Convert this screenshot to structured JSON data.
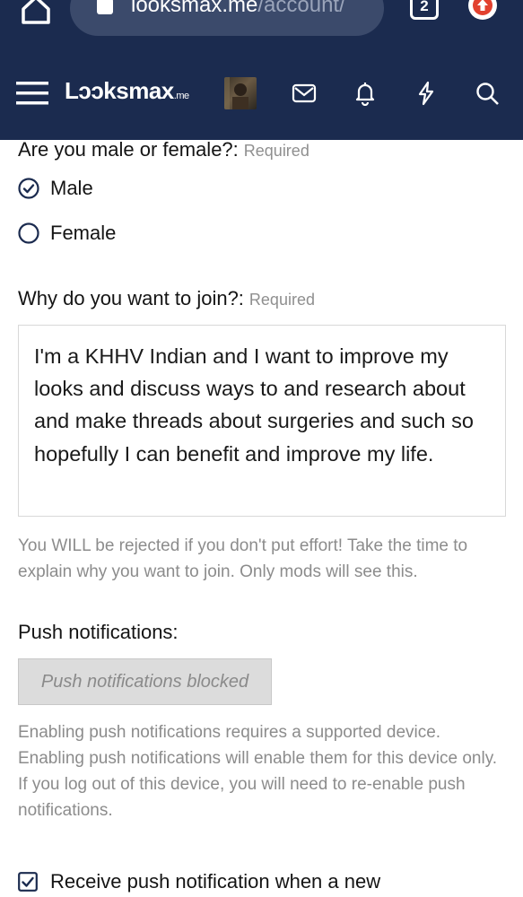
{
  "browser": {
    "url_domain": "looksmax.me",
    "url_path": "/account/",
    "tab_count": "2"
  },
  "header": {
    "logo_main": "Lɔɔksmax",
    "logo_suffix": ".me"
  },
  "gender": {
    "label": "Are you male or female?:",
    "required": "Required",
    "options": [
      "Male",
      "Female"
    ],
    "selected": "Male"
  },
  "join": {
    "label": "Why do you want to join?:",
    "required": "Required",
    "value": "I'm a KHHV Indian and I want to improve my looks and discuss ways to and research about and make threads about surgeries and such so hopefully I can benefit and improve my life.",
    "hint": "You WILL be rejected if you don't put effort! Take the time to explain why you want to join. Only mods will see this."
  },
  "push": {
    "label": "Push notifications:",
    "button": "Push notifications blocked",
    "hint": "Enabling push notifications requires a supported device. Enabling push notifications will enable them for this device only. If you log out of this device, you will need to re-enable push notifications.",
    "checkbox_label": "Receive push notification when a new"
  },
  "colors": {
    "header_bg": "#1b2b4f",
    "hint_text": "#8c8c8c"
  }
}
